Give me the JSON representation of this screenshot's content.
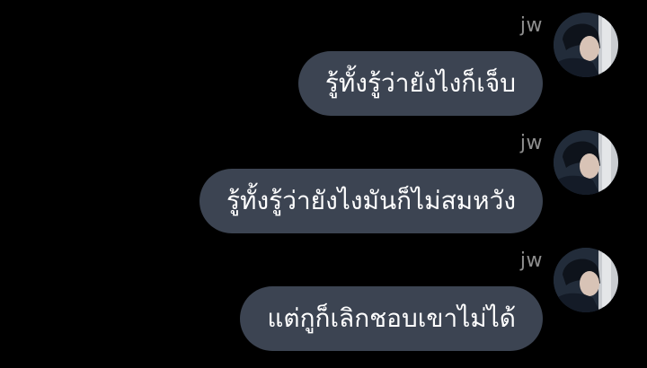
{
  "messages": [
    {
      "sender": "jw",
      "text": "รู้ทั้งรู้ว่ายังไงก็เจ็บ"
    },
    {
      "sender": "jw",
      "text": "รู้ทั้งรู้ว่ายังไงมันก็ไม่สมหวัง"
    },
    {
      "sender": "jw",
      "text": "แต่กูก็เลิกชอบเขาไม่ได้"
    }
  ],
  "colors": {
    "background": "#000000",
    "bubble": "#3c4452",
    "bubble_text": "#ffffff",
    "sender_name": "#8e8e8e"
  },
  "icons": {
    "avatar": "profile-photo"
  }
}
